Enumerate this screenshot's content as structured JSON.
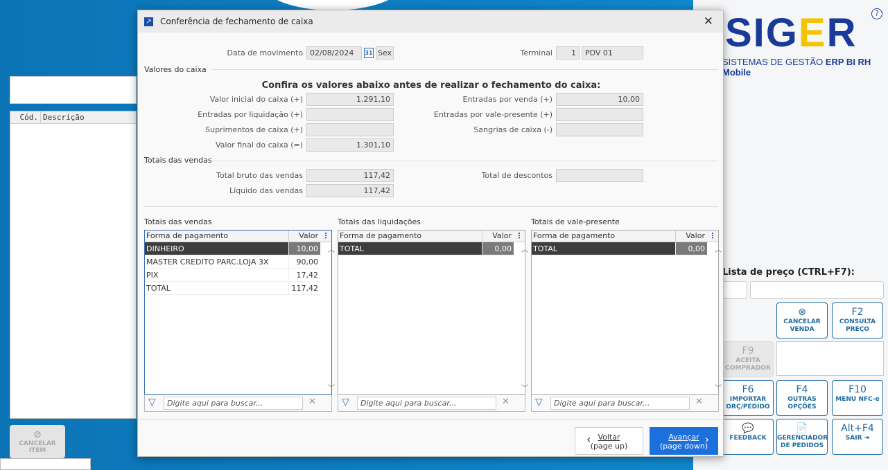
{
  "background": {
    "left_grid_header": {
      "code": "Cód.",
      "description": "Descrição"
    },
    "cancel_item_label": "CANCELAR ITEM",
    "logo": {
      "text_main": "SIG",
      "text_accent": "E",
      "text_end": "R",
      "subtitle": "SISTEMAS DE GESTÃO",
      "products": "ERP  BI  RH  Mobile"
    },
    "help_label": "?",
    "price_list_label": "Lista de preço (CTRL+F7):",
    "buttons": [
      {
        "key": "⊗",
        "label": "CANCELAR VENDA"
      },
      {
        "key": "F2",
        "label": "CONSULTA PREÇO"
      },
      {
        "key": "F9",
        "label": "ACEITA COMPRADOR"
      },
      {
        "key": "F6",
        "label": "IMPORTAR ORÇ/PEDIDO"
      },
      {
        "key": "F4",
        "label": "OUTRAS OPÇÕES"
      },
      {
        "key": "F10",
        "label": "MENU NFC-e"
      },
      {
        "key": "💬",
        "label": "FEEDBACK"
      },
      {
        "key": "📄",
        "label": "GERENCIADOR DE PEDIDOS"
      },
      {
        "key": "Alt+F4",
        "label": "SAIR ⇥"
      }
    ]
  },
  "dialog": {
    "title": "Conferência de fechamento de caixa",
    "close": "✕",
    "date_label": "Data de movimento",
    "date_value": "02/08/2024",
    "calendar_icon": "31",
    "weekday": "Sex",
    "terminal_label": "Terminal",
    "terminal_number": "1",
    "terminal_name": "PDV 01",
    "section_values": "Valores do caixa",
    "heading": "Confira os valores abaixo antes de realizar o fechamento do caixa:",
    "left_fields": [
      {
        "label": "Valor inicial do caixa (+)",
        "value": "1.291,10"
      },
      {
        "label": "Entradas por liquidação (+)",
        "value": ""
      },
      {
        "label": "Suprimentos de caixa (+)",
        "value": ""
      },
      {
        "label": "Valor final do caixa (=)",
        "value": "1.301,10"
      }
    ],
    "right_fields": [
      {
        "label": "Entradas por venda (+)",
        "value": "10,00"
      },
      {
        "label": "Entradas por vale-presente (+)",
        "value": ""
      },
      {
        "label": "Sangrias de caixa (-)",
        "value": ""
      }
    ],
    "section_sales": "Totais das vendas",
    "sales_fields": [
      {
        "label": "Total bruto das vendas",
        "value": "117,42"
      },
      {
        "label": "Líquido das vendas",
        "value": "117,42"
      }
    ],
    "discount_field": {
      "label": "Total de descontos",
      "value": ""
    },
    "grids": [
      {
        "title": "Totais das vendas",
        "col1": "Forma de pagamento",
        "col2": "Valor",
        "rows": [
          [
            "DINHEIRO",
            "10,00"
          ],
          [
            "MASTER CREDITO PARC.LOJA  3X",
            "90,00"
          ],
          [
            "PIX",
            "17,42"
          ],
          [
            "TOTAL",
            "117,42"
          ]
        ]
      },
      {
        "title": "Totais das liquidações",
        "col1": "Forma de pagamento",
        "col2": "Valor",
        "rows": [
          [
            "TOTAL",
            "0,00"
          ]
        ]
      },
      {
        "title": "Totais de vale-presente",
        "col1": "Forma de pagamento",
        "col2": "Valor",
        "rows": [
          [
            "TOTAL",
            "0,00"
          ]
        ]
      }
    ],
    "search_placeholder": "Digite aqui para buscar...",
    "back_button": {
      "line1": "Voltar",
      "line2": "(page up)"
    },
    "next_button": {
      "line1": "Avançar",
      "line2": "(page down)"
    }
  }
}
